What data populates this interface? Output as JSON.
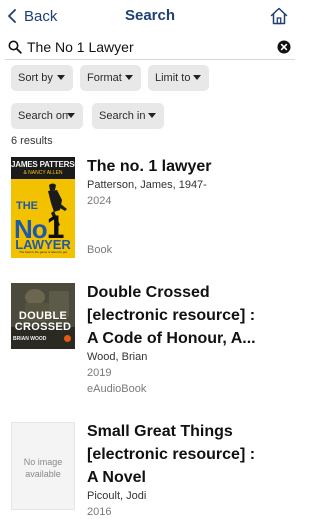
{
  "nav": {
    "back_label": "Back",
    "title": "Search",
    "back_icon": "chevron-left-icon",
    "home_icon": "home-icon"
  },
  "search": {
    "value": "The No 1 Lawyer",
    "search_icon": "magnifier-icon",
    "clear_icon": "clear-circle-icon"
  },
  "filters": {
    "sort_by": "Sort by",
    "format": "Format",
    "limit_to": "Limit to",
    "search_on": "Search on",
    "search_in": "Search in"
  },
  "results_count": "6 results",
  "results": [
    {
      "title_lines": [
        "The no. 1 lawyer"
      ],
      "author": "Patterson, James, 1947-",
      "year": "2024",
      "format": "Book",
      "cover": {
        "author_line": "JAMES PATTERSON",
        "coauthor_line": "& NANCY ALLEN",
        "title_top": "THE",
        "title_no": "No",
        "title_one": "1",
        "title_bottom": "LAWYER",
        "tagline": "The best in the game is about to get"
      }
    },
    {
      "title_lines": [
        "Double Crossed",
        "[electronic resource] :",
        "A Code of Honour, A..."
      ],
      "author": "Wood, Brian",
      "year": "2019",
      "format": "eAudioBook",
      "cover": {
        "line1": "DOUBLE",
        "line2": "CROSSED",
        "author_line": "BRIAN WOOD"
      }
    },
    {
      "title_lines": [
        "Small Great Things",
        "[electronic resource] :",
        "A Novel"
      ],
      "author": "Picoult, Jodi",
      "year": "2016",
      "cover": {
        "placeholder": "No image available"
      }
    }
  ],
  "colors": {
    "accent": "#1f3f78",
    "chip_bg": "#e8e8e8",
    "cover1_bg": "#f2c200",
    "cover1_band": "#1b1b1b",
    "cover1_title": "#1e5aa8",
    "cover2_bg": "#3a3b30"
  }
}
